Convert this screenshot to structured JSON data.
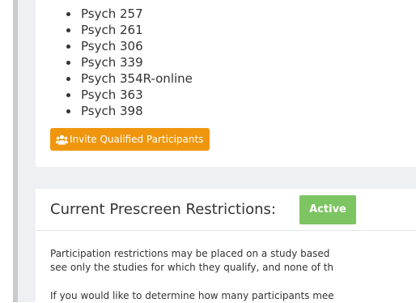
{
  "courses": [
    "Psych 257",
    "Psych 261",
    "Psych 306",
    "Psych 339",
    "Psych 354R-online",
    "Psych 363",
    "Psych 398"
  ],
  "invite_button": {
    "label": "Invite Qualified Participants",
    "icon": "users-icon",
    "color": "#f0960e"
  },
  "prescreen": {
    "title": "Current Prescreen Restrictions:",
    "status": "Active",
    "status_color": "#7dc462",
    "paragraph_1_line_1": "Participation restrictions may be placed on a study based",
    "paragraph_1_line_2": "see only the studies for which they qualify, and none of th",
    "paragraph_2_line_1": "If you would like to determine how many participants mee"
  }
}
